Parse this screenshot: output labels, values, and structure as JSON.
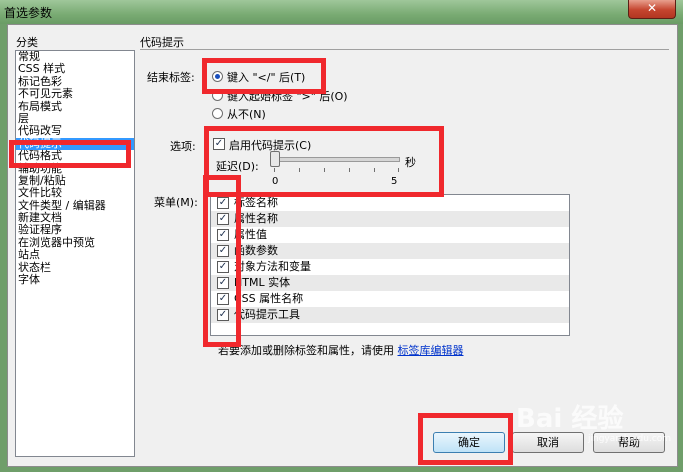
{
  "window": {
    "title": "首选参数",
    "close_glyph": "✕"
  },
  "categories": {
    "label": "分类",
    "items": [
      "常规",
      "CSS 样式",
      "标记色彩",
      "不可见元素",
      "布局模式",
      "层",
      "代码改写",
      "代码提示",
      "代码格式",
      "辅助功能",
      "复制/粘贴",
      "文件比较",
      "文件类型 / 编辑器",
      "新建文档",
      "验证程序",
      "在浏览器中预览",
      "站点",
      "状态栏",
      "字体"
    ],
    "selected": "代码提示"
  },
  "section_title": "代码提示",
  "close_tags": {
    "label": "结束标签:",
    "options": [
      "键入 \"</\" 后(T)",
      "键入起始标签 \">\" 后(O)",
      "从不(N)"
    ],
    "selected": "键入 \"</\" 后(T)"
  },
  "options": {
    "label": "选项:",
    "enable_hints_label": "启用代码提示(C)",
    "enable_hints_checked": true,
    "delay_label": "延迟(D):",
    "delay_value": 0,
    "delay_min": "0",
    "delay_max": "5",
    "delay_unit": "秒"
  },
  "menus": {
    "label": "菜单(M):",
    "items": [
      {
        "label": "标签名称",
        "checked": true
      },
      {
        "label": "属性名称",
        "checked": true
      },
      {
        "label": "属性值",
        "checked": true
      },
      {
        "label": "函数参数",
        "checked": true
      },
      {
        "label": "对象方法和变量",
        "checked": true
      },
      {
        "label": "HTML 实体",
        "checked": true
      },
      {
        "label": "CSS 属性名称",
        "checked": true
      },
      {
        "label": "代码提示工具",
        "checked": true
      }
    ]
  },
  "footer_note": {
    "text": "若要添加或删除标签和属性，请使用",
    "link": "标签库编辑器"
  },
  "buttons": {
    "ok": "确定",
    "cancel": "取消",
    "help": "帮助"
  },
  "watermark": {
    "text": "Bai 经验",
    "url": "jingyan.baidu.com"
  }
}
